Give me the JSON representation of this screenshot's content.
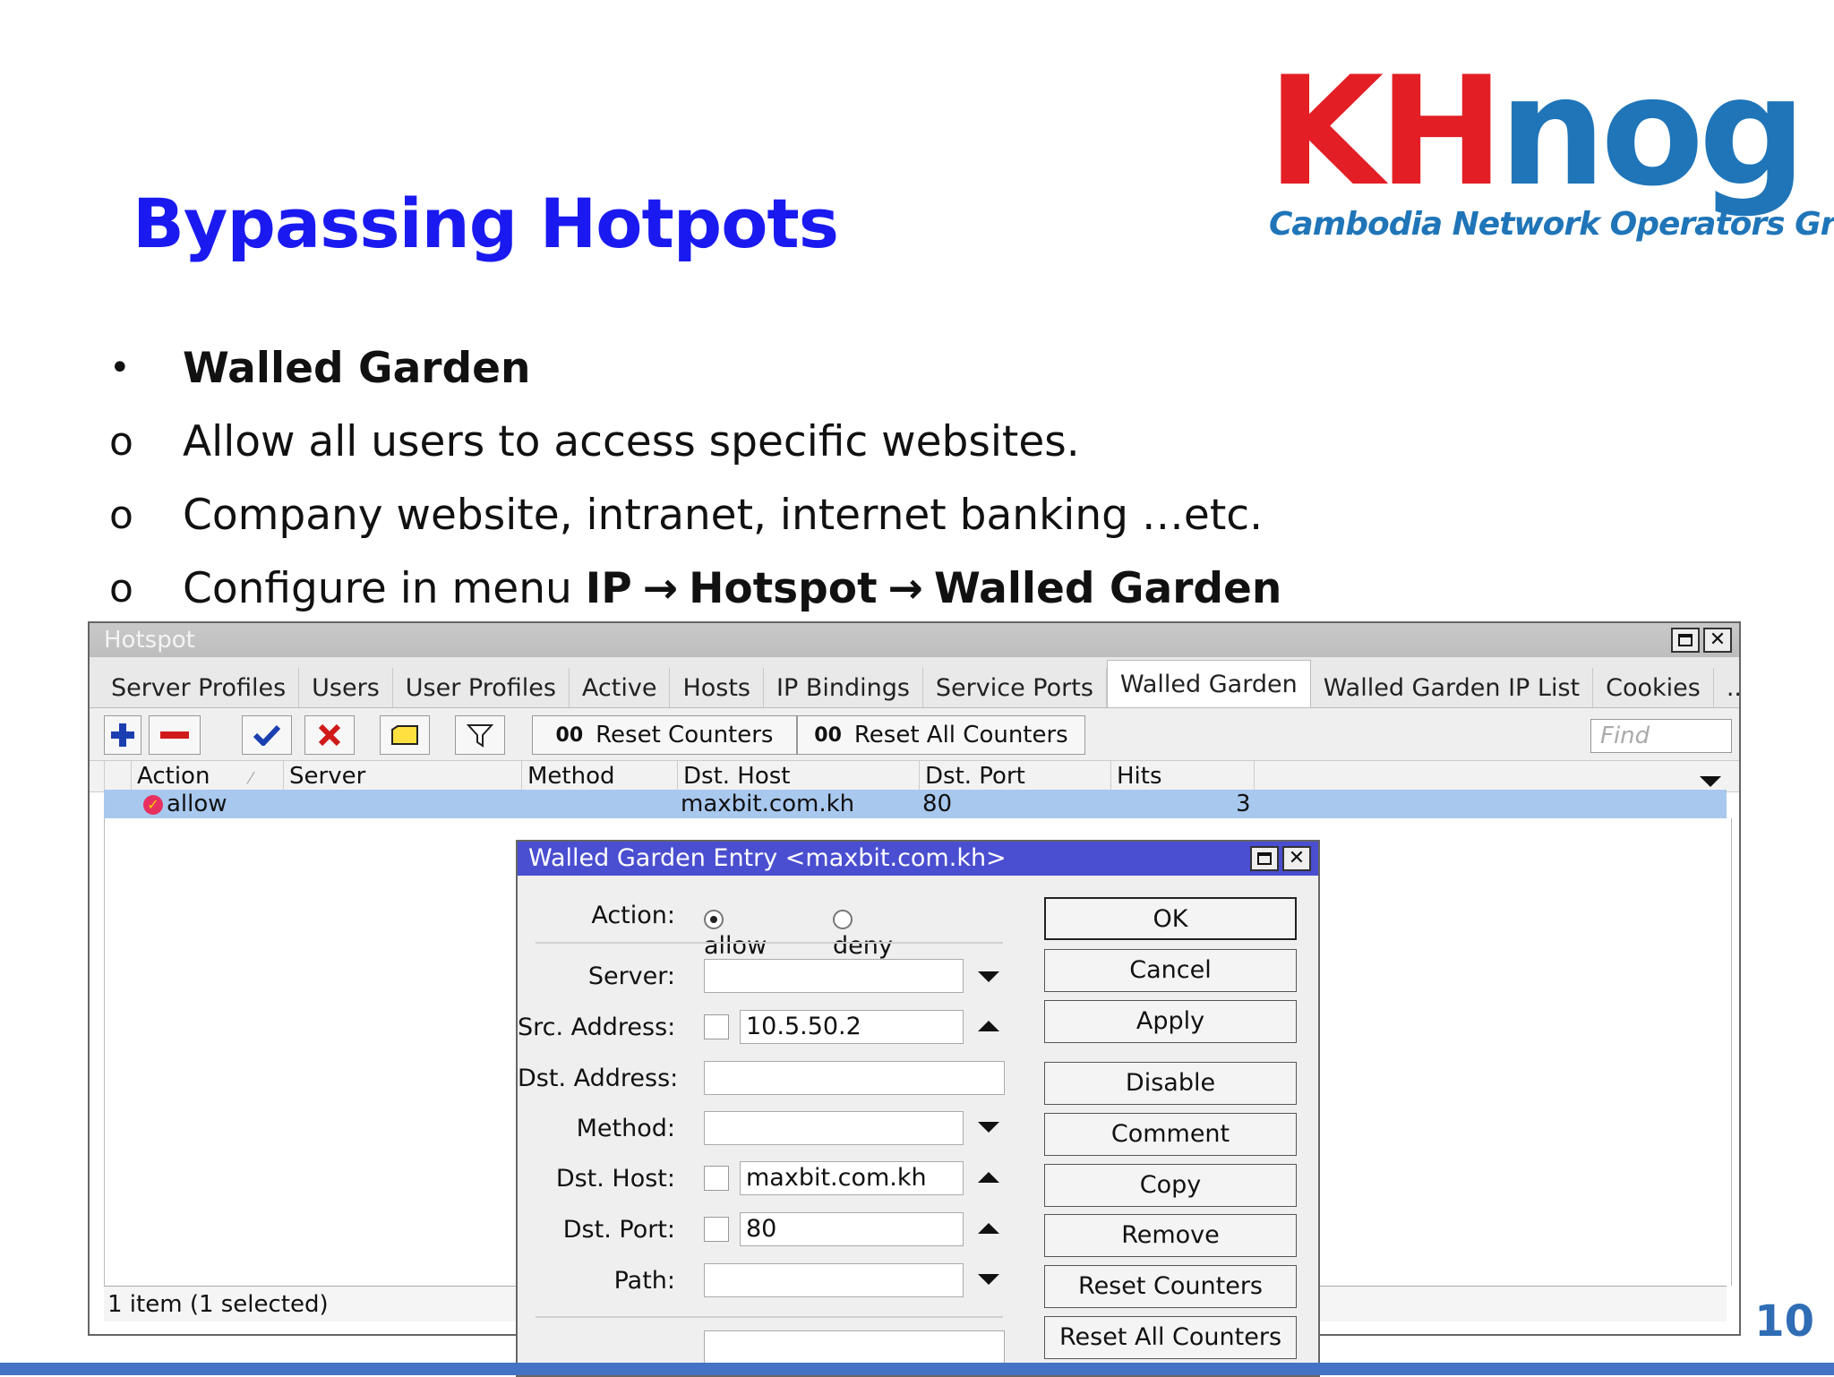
{
  "slide": {
    "title": "Bypassing Hotpots",
    "page_number": "10",
    "logo": {
      "kh": "KH",
      "nog": "nog",
      "subtitle": "Cambodia Network Operators Group"
    },
    "bullets": {
      "heading": "Walled Garden",
      "item1": "Allow all users to access specific websites.",
      "item2": "Company website, intranet, internet banking …etc.",
      "item3_prefix": "Configure in menu ",
      "item3_ip": "IP",
      "item3_hotspot": "Hotspot",
      "item3_walled": "Walled Garden",
      "arrow": "→",
      "bullet_marker": "•",
      "sub_marker": "o"
    },
    "colors": {
      "title": "#1a1af0",
      "logo_red": "#e31e24",
      "logo_blue": "#1f75b8",
      "footer_bar": "#4472c4"
    }
  },
  "hotspot_window": {
    "title": "Hotspot",
    "tabs": [
      "Server Profiles",
      "Users",
      "User Profiles",
      "Active",
      "Hosts",
      "IP Bindings",
      "Service Ports",
      "Walled Garden",
      "Walled Garden IP List",
      "Cookies",
      "..."
    ],
    "active_tab": "Walled Garden",
    "toolbar": {
      "reset_counters": "Reset Counters",
      "reset_all_counters": "Reset All Counters",
      "oo": "00",
      "find_placeholder": "Find"
    },
    "columns": {
      "action": "Action",
      "server": "Server",
      "method": "Method",
      "dst_host": "Dst. Host",
      "dst_port": "Dst. Port",
      "hits": "Hits"
    },
    "row": {
      "action": "allow",
      "server": "",
      "method": "",
      "dst_host": "maxbit.com.kh",
      "dst_port": "80",
      "hits": "3"
    },
    "status": "1 item (1 selected)"
  },
  "dialog": {
    "title": "Walled Garden Entry <maxbit.com.kh>",
    "action_label": "Action:",
    "allow": "allow",
    "deny": "deny",
    "server_label": "Server:",
    "src_address_label": "Src. Address:",
    "src_address_value": "10.5.50.2",
    "dst_address_label": "Dst. Address:",
    "method_label": "Method:",
    "dst_host_label": "Dst. Host:",
    "dst_host_value": "maxbit.com.kh",
    "dst_port_label": "Dst. Port:",
    "dst_port_value": "80",
    "path_label": "Path:",
    "buttons": {
      "ok": "OK",
      "cancel": "Cancel",
      "apply": "Apply",
      "disable": "Disable",
      "comment": "Comment",
      "copy": "Copy",
      "remove": "Remove",
      "reset_counters": "Reset Counters",
      "reset_all_counters": "Reset All Counters"
    }
  }
}
